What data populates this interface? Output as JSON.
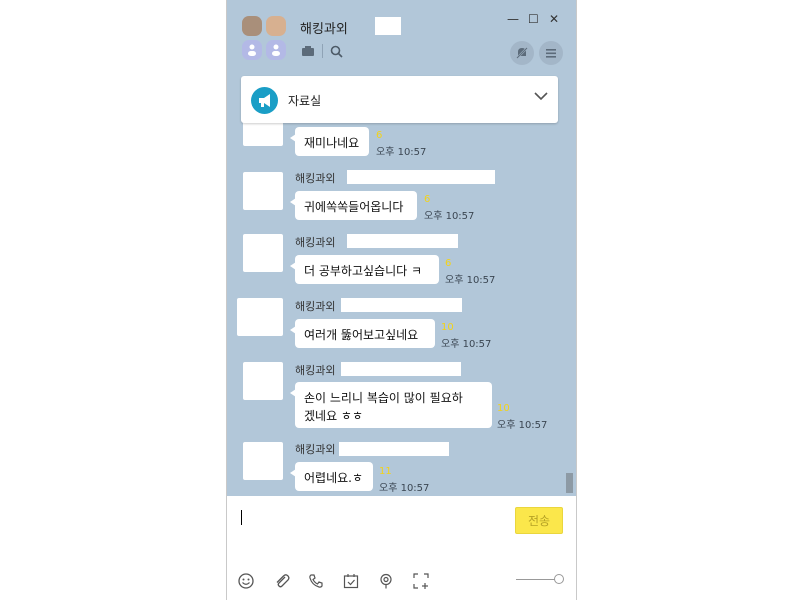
{
  "header": {
    "title": "해킹과외",
    "minimize_label": "—",
    "maximize_label": "☐",
    "close_label": "✕"
  },
  "notice": {
    "label": "자료실"
  },
  "messages": [
    {
      "text": "재미나네요",
      "unread": "6",
      "time": "오후 10:57"
    },
    {
      "sender": "해킹과외",
      "text": "귀에쏙쏙들어옵니다",
      "unread": "6",
      "time": "오후 10:57"
    },
    {
      "sender": "해킹과외",
      "text": "더 공부하고싶습니다 ㅋ",
      "unread": "6",
      "time": "오후 10:57"
    },
    {
      "sender": "해킹과외",
      "text": "여러개 뚫어보고싶네요",
      "unread": "10",
      "time": "오후 10:57"
    },
    {
      "sender": "해킹과외",
      "text_line1": "손이 느리니 복습이 많이 필요하",
      "text_line2": "겠네요 ㅎㅎ",
      "unread": "10",
      "time": "오후 10:57"
    },
    {
      "sender": "해킹과외",
      "text": "어렵네요.ㅎ",
      "unread": "11",
      "time": "오후 10:57"
    }
  ],
  "input": {
    "send_label": "전송"
  },
  "icons": {
    "search": "search-icon",
    "folder": "folder-icon",
    "mute": "mute-bell-icon",
    "menu": "menu-icon",
    "notice": "megaphone-icon",
    "emoji": "emoji-icon",
    "attach": "paperclip-icon",
    "call": "phone-icon",
    "schedule": "calendar-check-icon",
    "location": "location-pin-icon",
    "capture": "capture-icon"
  },
  "colors": {
    "chat_bg": "#b2c7d9",
    "send_button": "#fbe74b",
    "unread": "#f3d319",
    "notice_icon": "#1a9ec6"
  }
}
